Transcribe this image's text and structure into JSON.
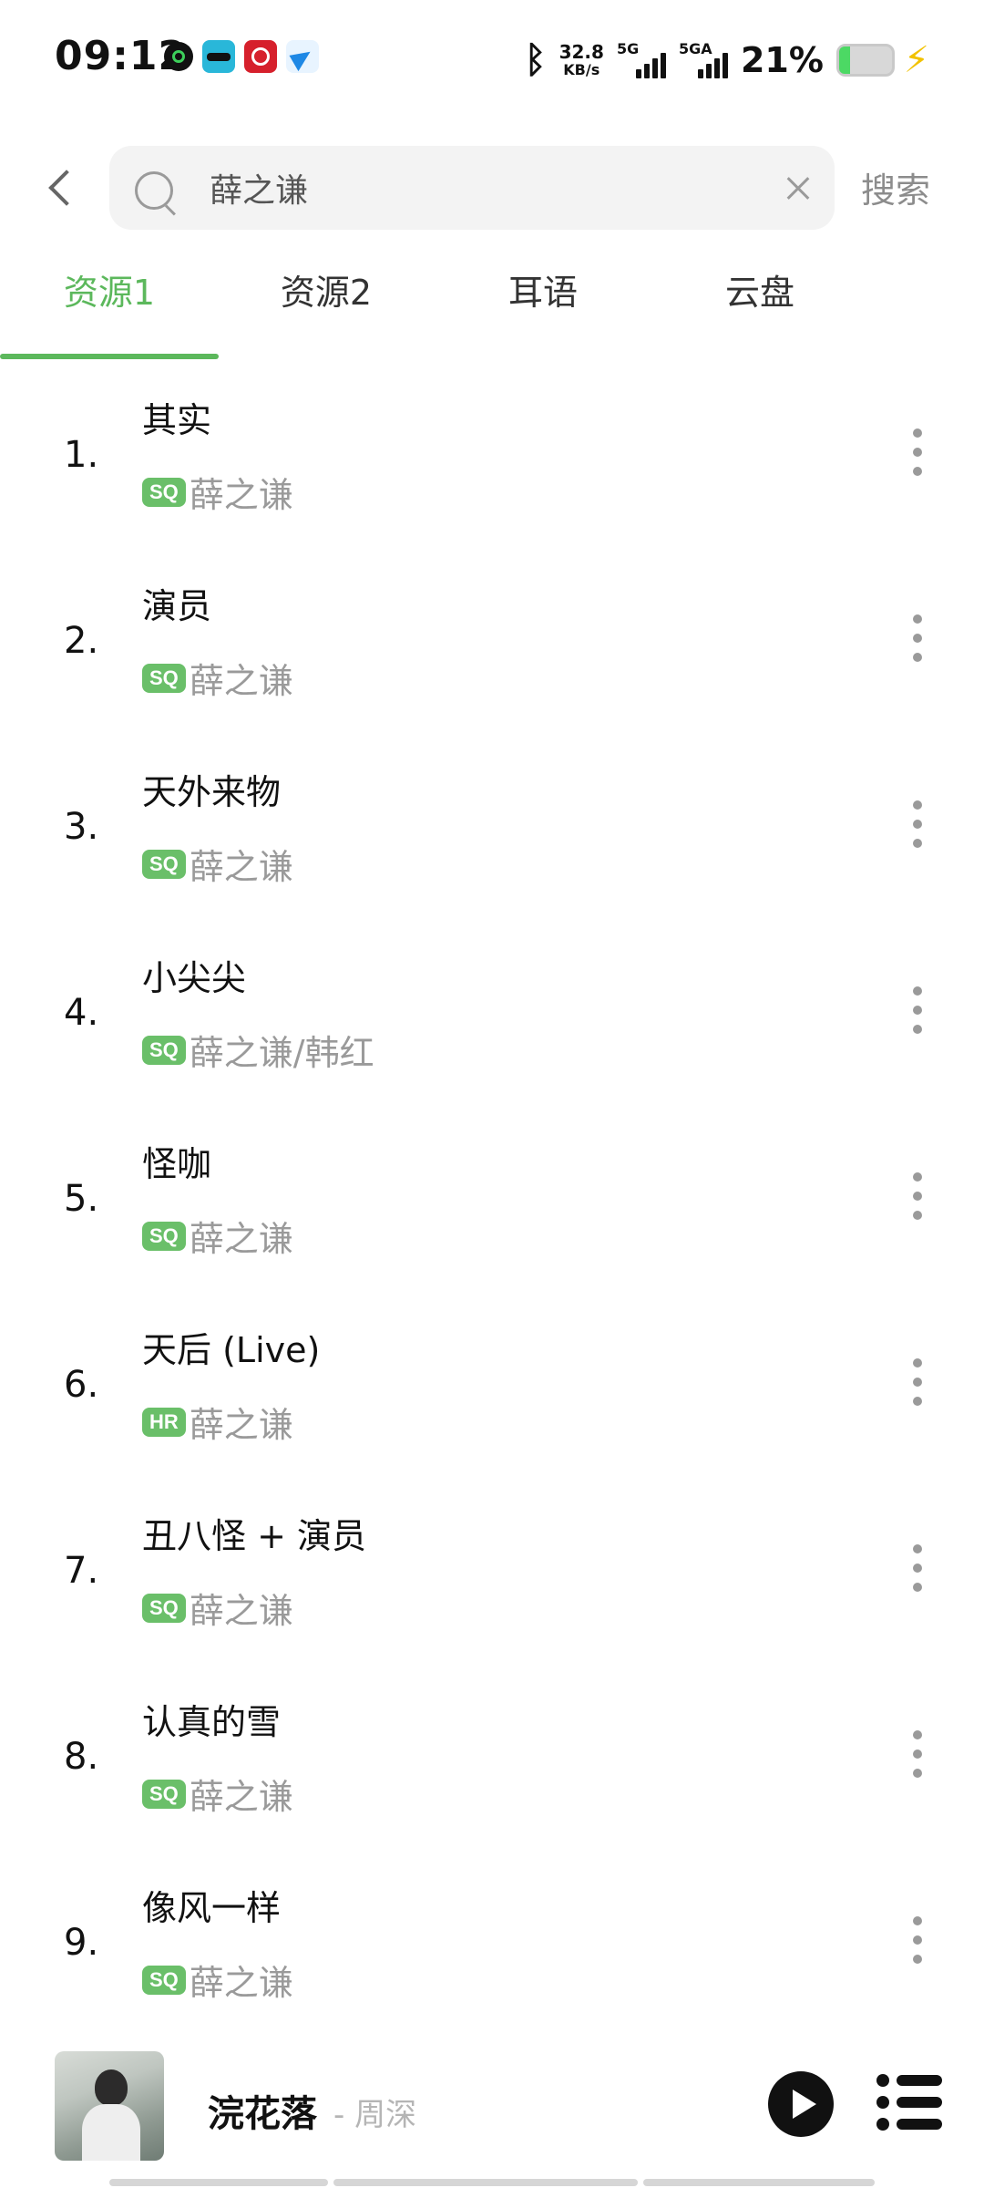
{
  "status_bar": {
    "time": "09:12",
    "app_icons": [
      "message-app-icon",
      "magic-app-icon",
      "red-app-icon",
      "telegram-icon"
    ],
    "bluetooth_icon": "bluetooth-icon",
    "net_speed_value": "32.8",
    "net_speed_unit": "KB/s",
    "signal1_label": "5G",
    "signal2_label": "5GA",
    "battery_percent": "21%",
    "battery_level": 0.21,
    "charging_icon": "lightning-bolt-icon",
    "battery_color": "#4cd964",
    "charging_color": "#f2c200"
  },
  "search": {
    "query": "薛之谦",
    "button_label": "搜索"
  },
  "tabs": [
    {
      "label": "资源1",
      "active": true
    },
    {
      "label": "资源2",
      "active": false
    },
    {
      "label": "耳语",
      "active": false
    },
    {
      "label": "云盘",
      "active": false
    }
  ],
  "accent_color": "#5cb85c",
  "songs": [
    {
      "index": "1.",
      "title": "其实",
      "quality": "SQ",
      "artist": "薛之谦"
    },
    {
      "index": "2.",
      "title": "演员",
      "quality": "SQ",
      "artist": "薛之谦"
    },
    {
      "index": "3.",
      "title": "天外来物",
      "quality": "SQ",
      "artist": "薛之谦"
    },
    {
      "index": "4.",
      "title": "小尖尖",
      "quality": "SQ",
      "artist": "薛之谦/韩红"
    },
    {
      "index": "5.",
      "title": "怪咖",
      "quality": "SQ",
      "artist": "薛之谦"
    },
    {
      "index": "6.",
      "title": "天后 (Live)",
      "quality": "HR",
      "artist": "薛之谦"
    },
    {
      "index": "7.",
      "title": "丑八怪 + 演员",
      "quality": "SQ",
      "artist": "薛之谦"
    },
    {
      "index": "8.",
      "title": "认真的雪",
      "quality": "SQ",
      "artist": "薛之谦"
    },
    {
      "index": "9.",
      "title": "像风一样",
      "quality": "SQ",
      "artist": "薛之谦"
    }
  ],
  "now_playing": {
    "title": "浣花落",
    "artist": "- 周深"
  }
}
